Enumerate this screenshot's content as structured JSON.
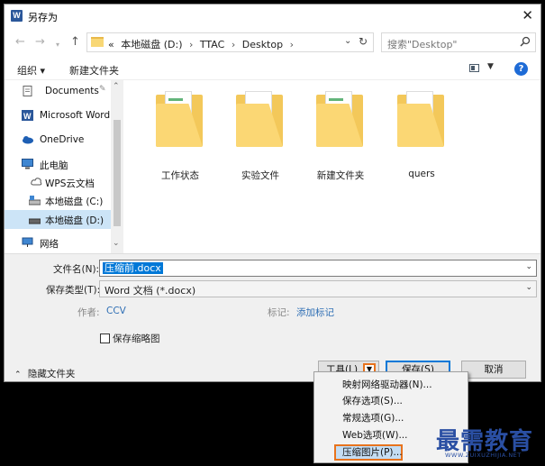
{
  "window": {
    "title": "另存为",
    "app_icon": "W"
  },
  "address": {
    "prefix": "«",
    "crumbs": [
      "本地磁盘 (D:)",
      "TTAC",
      "Desktop"
    ],
    "separator": "›"
  },
  "search": {
    "placeholder": "搜索\"Desktop\""
  },
  "toolbar": {
    "organize": "组织 ▾",
    "new_folder": "新建文件夹",
    "help": "?"
  },
  "sidebar": {
    "items": [
      {
        "label": "Documents",
        "icon": "document-icon"
      },
      {
        "label": "Microsoft Word",
        "icon": "word-icon"
      },
      {
        "label": "OneDrive",
        "icon": "cloud-icon"
      },
      {
        "label": "此电脑",
        "icon": "computer-icon"
      },
      {
        "label": "WPS云文档",
        "icon": "cloud-outline-icon"
      },
      {
        "label": "本地磁盘 (C:)",
        "icon": "drive-icon"
      },
      {
        "label": "本地磁盘 (D:)",
        "icon": "drive-icon"
      },
      {
        "label": "网络",
        "icon": "network-icon"
      }
    ]
  },
  "folders": [
    {
      "label": "工作状态"
    },
    {
      "label": "实验文件"
    },
    {
      "label": "新建文件夹"
    },
    {
      "label": "quers"
    }
  ],
  "form": {
    "filename_label": "文件名(N):",
    "filename_value": "压缩前.docx",
    "filetype_label": "保存类型(T):",
    "filetype_value": "Word 文档 (*.docx)",
    "author_label": "作者:",
    "author_value": "CCV",
    "tags_label": "标记:",
    "tags_value": "添加标记",
    "thumbnail_label": "保存缩略图"
  },
  "footer": {
    "hide_folders": "隐藏文件夹",
    "tools": "工具(L)",
    "save": "保存(S)",
    "cancel": "取消"
  },
  "tools_menu": {
    "items": [
      "映射网络驱动器(N)...",
      "保存选项(S)...",
      "常规选项(G)...",
      "Web选项(W)...",
      "压缩图片(P)..."
    ]
  },
  "watermark": {
    "main": "最需教育",
    "sub": "WWW.ZUIXUZHIJIA.NET"
  },
  "colors": {
    "accent": "#0078d7",
    "highlight": "#e8731d",
    "folder": "#f8d775",
    "link": "#2f6fb5"
  }
}
